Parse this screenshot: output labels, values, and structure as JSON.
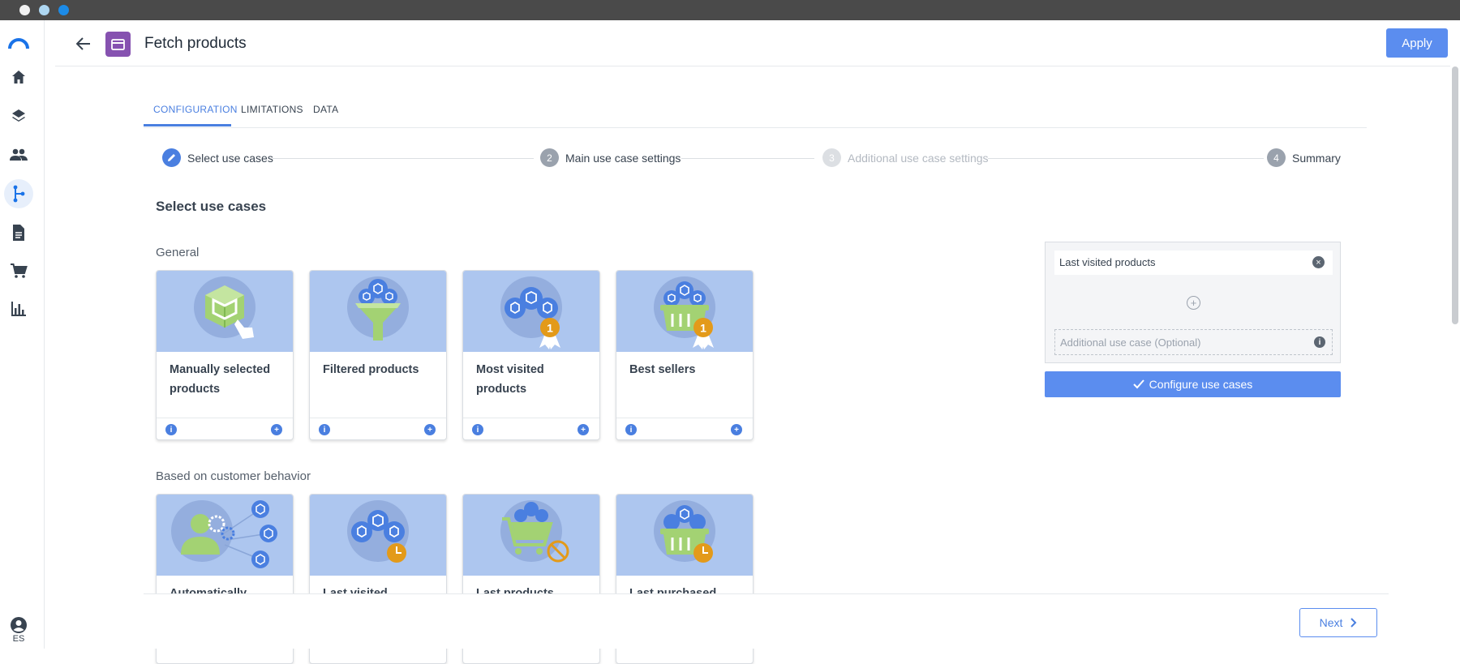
{
  "app": {
    "lang": "ES"
  },
  "header": {
    "title": "Fetch products",
    "apply_label": "Apply"
  },
  "tabs": [
    {
      "label": "CONFIGURATION",
      "active": true
    },
    {
      "label": "LIMITATIONS",
      "active": false
    },
    {
      "label": "DATA",
      "active": false
    }
  ],
  "stepper": [
    {
      "number": "",
      "label": "Select use cases",
      "state": "active"
    },
    {
      "number": "2",
      "label": "Main use case settings",
      "state": "normal"
    },
    {
      "number": "3",
      "label": "Additional use case settings",
      "state": "disabled"
    },
    {
      "number": "4",
      "label": "Summary",
      "state": "normal"
    }
  ],
  "main": {
    "section_title": "Select use cases",
    "groups": [
      {
        "label": "General",
        "cards": [
          {
            "label": "Manually selected products",
            "icon": "cube-hand-icon"
          },
          {
            "label": "Filtered products",
            "icon": "funnel-cubes-icon"
          },
          {
            "label": "Most visited products",
            "icon": "cubes-medal-icon"
          },
          {
            "label": "Best sellers",
            "icon": "basket-medal-icon"
          }
        ]
      },
      {
        "label": "Based on customer behavior",
        "cards": [
          {
            "label": "Automatically",
            "icon": "person-network-icon"
          },
          {
            "label": "Last visited products",
            "icon": "cubes-clock-icon"
          },
          {
            "label": "Last products added",
            "icon": "cart-forbidden-icon"
          },
          {
            "label": "Last purchased",
            "icon": "basket-clock-icon"
          }
        ]
      }
    ]
  },
  "use_case_panel": {
    "selected": "Last visited products",
    "additional_placeholder": "Additional use case (Optional)",
    "configure_label": "Configure use cases"
  },
  "footer": {
    "next_label": "Next"
  },
  "colors": {
    "accent": "#5b8def",
    "card_image_bg": "#adc6ef",
    "icon_green": "#a3d273",
    "medal_orange": "#e39a1a",
    "node_purple": "#8652b0"
  }
}
